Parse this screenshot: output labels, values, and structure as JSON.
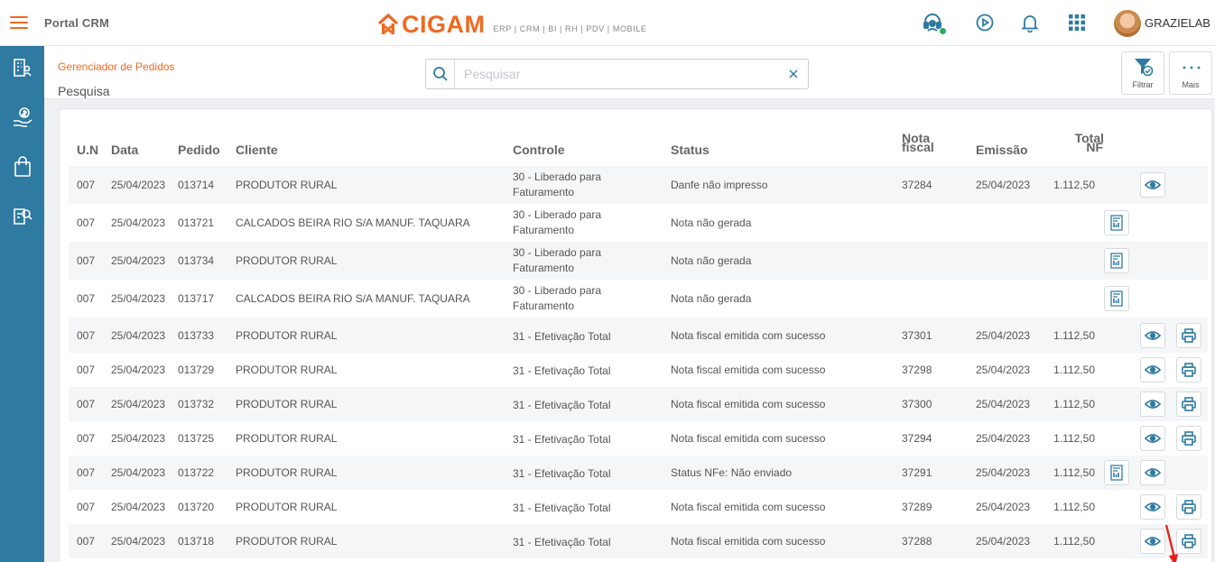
{
  "header": {
    "app_title": "Portal CRM",
    "logo_text": "CIGAM",
    "logo_tagline": "ERP | CRM | BI | RH | PDV | MOBILE",
    "username": "GRAZIELAB",
    "icons": [
      "menu-icon",
      "support-headset-icon",
      "play-circle-icon",
      "bell-icon",
      "apps-grid-icon"
    ]
  },
  "sidebar": {
    "icons": [
      "building-user-icon",
      "hand-money-icon",
      "shopping-bag-icon",
      "document-search-icon"
    ]
  },
  "page": {
    "breadcrumb": "Gerenciador de Pedidos",
    "title": "Pesquisa",
    "search_placeholder": "Pesquisar",
    "filter_label": "Filtrar",
    "more_label": "Mais"
  },
  "table": {
    "columns": {
      "un": "U.N",
      "data": "Data",
      "pedido": "Pedido",
      "cliente": "Cliente",
      "controle": "Controle",
      "status": "Status",
      "nota1": "Nota",
      "nota2": "fiscal",
      "emissao": "Emissão",
      "total1": "Total",
      "total2": "NF"
    },
    "rows": [
      {
        "un": "007",
        "data": "25/04/2023",
        "pedido": "013714",
        "cliente": "PRODUTOR RURAL",
        "controle": "30 - Liberado para Faturamento",
        "status": "Danfe não impresso",
        "nota": "37284",
        "emissao": "25/04/2023",
        "total": "1.112,50",
        "actions": [
          "view"
        ]
      },
      {
        "un": "007",
        "data": "25/04/2023",
        "pedido": "013721",
        "cliente": "CALCADOS BEIRA RIO S/A MANUF. TAQUARA",
        "controle": "30 - Liberado para Faturamento",
        "status": "Nota não gerada",
        "nota": "",
        "emissao": "",
        "total": "",
        "actions": [
          "invoice"
        ]
      },
      {
        "un": "007",
        "data": "25/04/2023",
        "pedido": "013734",
        "cliente": "PRODUTOR RURAL",
        "controle": "30 - Liberado para Faturamento",
        "status": "Nota não gerada",
        "nota": "",
        "emissao": "",
        "total": "",
        "actions": [
          "invoice"
        ]
      },
      {
        "un": "007",
        "data": "25/04/2023",
        "pedido": "013717",
        "cliente": "CALCADOS BEIRA RIO S/A MANUF. TAQUARA",
        "controle": "30 - Liberado para Faturamento",
        "status": "Nota não gerada",
        "nota": "",
        "emissao": "",
        "total": "",
        "actions": [
          "invoice"
        ]
      },
      {
        "un": "007",
        "data": "25/04/2023",
        "pedido": "013733",
        "cliente": "PRODUTOR RURAL",
        "controle": "31 - Efetivação Total",
        "status": "Nota fiscal emitida com sucesso",
        "nota": "37301",
        "emissao": "25/04/2023",
        "total": "1.112,50",
        "actions": [
          "view",
          "print"
        ]
      },
      {
        "un": "007",
        "data": "25/04/2023",
        "pedido": "013729",
        "cliente": "PRODUTOR RURAL",
        "controle": "31 - Efetivação Total",
        "status": "Nota fiscal emitida com sucesso",
        "nota": "37298",
        "emissao": "25/04/2023",
        "total": "1.112,50",
        "actions": [
          "view",
          "print"
        ]
      },
      {
        "un": "007",
        "data": "25/04/2023",
        "pedido": "013732",
        "cliente": "PRODUTOR RURAL",
        "controle": "31 - Efetivação Total",
        "status": "Nota fiscal emitida com sucesso",
        "nota": "37300",
        "emissao": "25/04/2023",
        "total": "1.112,50",
        "actions": [
          "view",
          "print"
        ]
      },
      {
        "un": "007",
        "data": "25/04/2023",
        "pedido": "013725",
        "cliente": "PRODUTOR RURAL",
        "controle": "31 - Efetivação Total",
        "status": "Nota fiscal emitida com sucesso",
        "nota": "37294",
        "emissao": "25/04/2023",
        "total": "1.112,50",
        "actions": [
          "view",
          "print"
        ]
      },
      {
        "un": "007",
        "data": "25/04/2023",
        "pedido": "013722",
        "cliente": "PRODUTOR RURAL",
        "controle": "31 - Efetivação Total",
        "status": "Status NFe: Não enviado",
        "nota": "37291",
        "emissao": "25/04/2023",
        "total": "1.112,50",
        "actions": [
          "invoice",
          "view"
        ]
      },
      {
        "un": "007",
        "data": "25/04/2023",
        "pedido": "013720",
        "cliente": "PRODUTOR RURAL",
        "controle": "31 - Efetivação Total",
        "status": "Nota fiscal emitida com sucesso",
        "nota": "37289",
        "emissao": "25/04/2023",
        "total": "1.112,50",
        "actions": [
          "view",
          "print"
        ]
      },
      {
        "un": "007",
        "data": "25/04/2023",
        "pedido": "013718",
        "cliente": "PRODUTOR RURAL",
        "controle": "31 - Efetivação Total",
        "status": "Nota fiscal emitida com sucesso",
        "nota": "37288",
        "emissao": "25/04/2023",
        "total": "1.112,50",
        "actions": [
          "view",
          "print"
        ]
      }
    ]
  },
  "colors": {
    "accent": "#ef6a21",
    "sidebar": "#2e7aa1",
    "icon_blue": "#2e7aa1",
    "annotation_arrow": "#e8201c"
  }
}
